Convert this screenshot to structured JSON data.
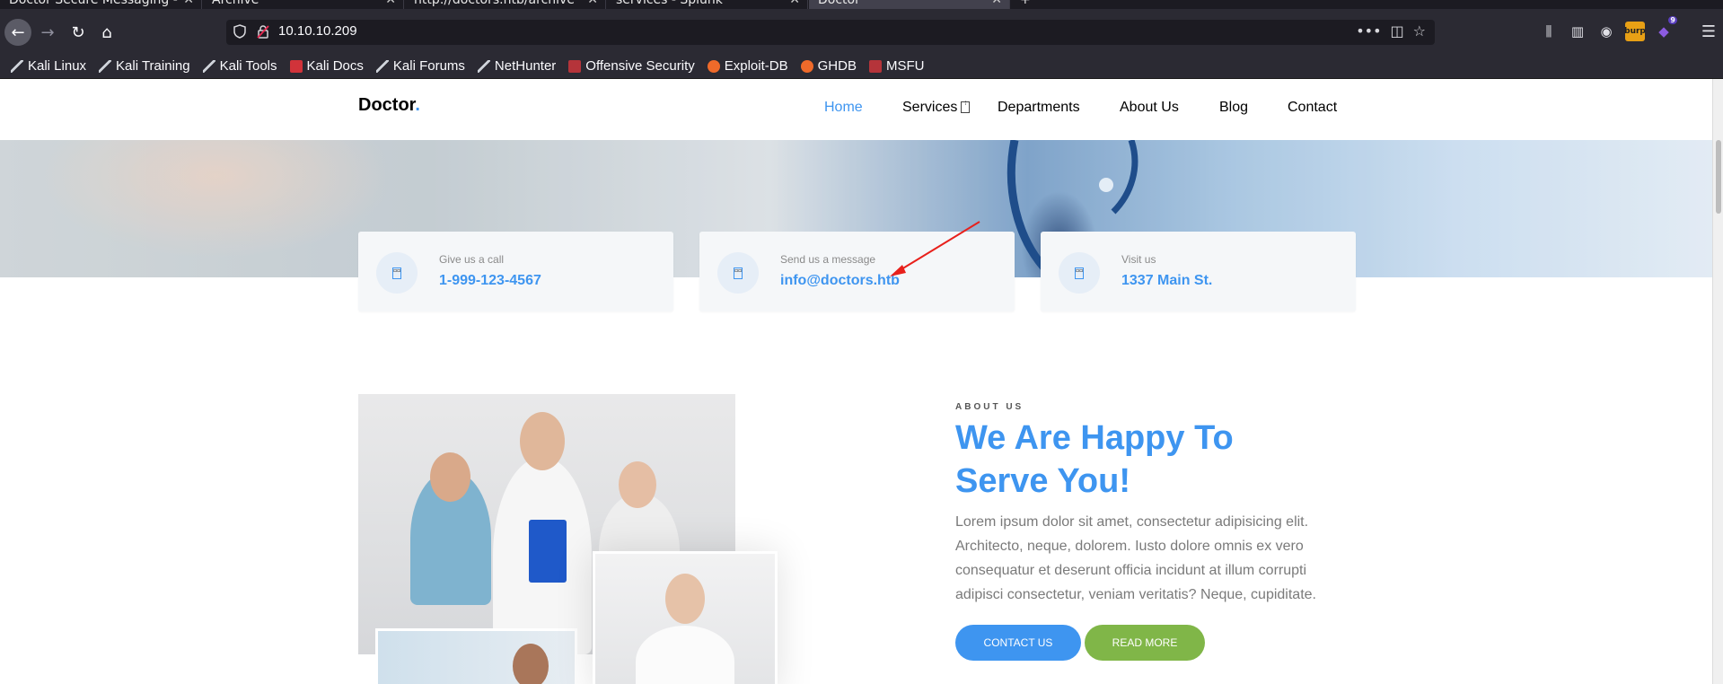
{
  "browser": {
    "tabs": [
      {
        "title": "Doctor Secure Messaging -"
      },
      {
        "title": "Archive"
      },
      {
        "title": "http://doctors.htb/archive"
      },
      {
        "title": "services - Splunk"
      },
      {
        "title": "Doctor",
        "active": true
      }
    ],
    "url": "10.10.10.209",
    "url_actions": [
      "more-icon",
      "pocket-icon",
      "bookmark-star-icon"
    ],
    "toolbar_icons": [
      "library-icon",
      "sidebar-icon",
      "account-icon",
      "burp-icon",
      "extension-icon"
    ],
    "burp_label": "burp",
    "extension_badge": "9",
    "bookmarks": [
      {
        "label": "Kali Linux",
        "icon": "kali"
      },
      {
        "label": "Kali Training",
        "icon": "kali"
      },
      {
        "label": "Kali Tools",
        "icon": "kali"
      },
      {
        "label": "Kali Docs",
        "icon": "kalidocs"
      },
      {
        "label": "Kali Forums",
        "icon": "kali"
      },
      {
        "label": "NetHunter",
        "icon": "kali"
      },
      {
        "label": "Offensive Security",
        "icon": "os"
      },
      {
        "label": "Exploit-DB",
        "icon": "edb"
      },
      {
        "label": "GHDB",
        "icon": "edb"
      },
      {
        "label": "MSFU",
        "icon": "os"
      }
    ]
  },
  "site": {
    "logo": "Doctor",
    "logo_dot": ".",
    "nav": [
      {
        "label": "Home",
        "active": true
      },
      {
        "label": "Services"
      },
      {
        "label": "Departments"
      },
      {
        "label": "About Us"
      },
      {
        "label": "Blog"
      },
      {
        "label": "Contact"
      }
    ],
    "info_cards": [
      {
        "label": "Give us a call",
        "value": "1-999-123-4567",
        "icon": "phone-icon"
      },
      {
        "label": "Send us a message",
        "value": "info@doctors.htb",
        "icon": "message-icon"
      },
      {
        "label": "Visit us",
        "value": "1337 Main St.",
        "icon": "location-icon"
      }
    ],
    "about": {
      "label": "ABOUT US",
      "title": "We Are Happy To Serve You!",
      "text": "Lorem ipsum dolor sit amet, consectetur adipisicing elit. Architecto, neque, dolorem. Iusto dolore omnis ex vero consequatur et deserunt officia incidunt at illum corrupti adipisci consectetur, veniam veritatis? Neque, cupiditate.",
      "btn_contact": "CONTACT US",
      "btn_read": "READ MORE"
    }
  },
  "colors": {
    "accent": "#3e95f0",
    "secondary": "#80b648",
    "annotation_arrow": "#e8201b"
  }
}
